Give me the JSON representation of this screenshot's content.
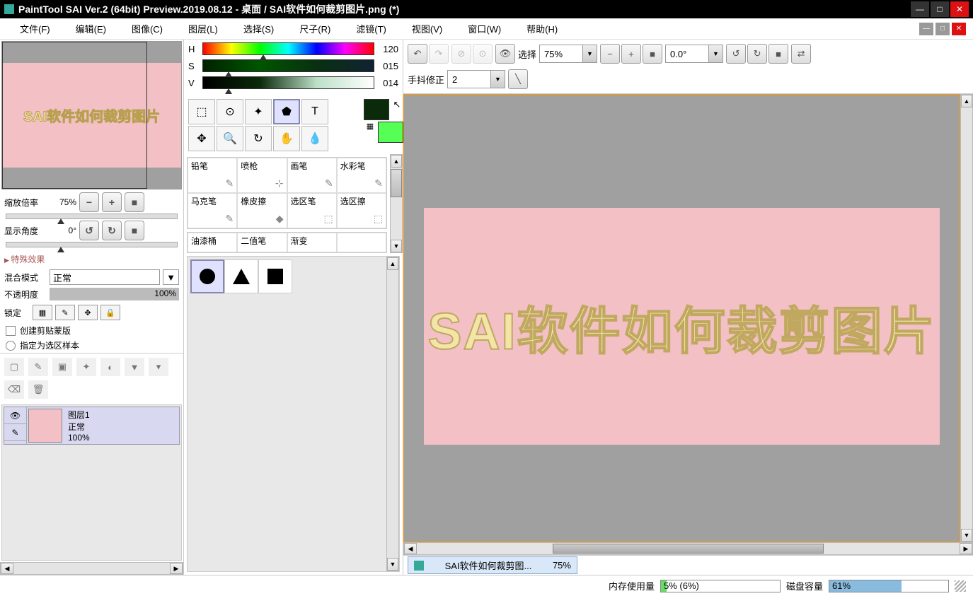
{
  "window": {
    "title": "PaintTool SAI Ver.2 (64bit) Preview.2019.08.12 - 桌面 / SAI软件如何裁剪图片.png (*)"
  },
  "menu": {
    "file": "文件(F)",
    "edit": "编辑(E)",
    "image": "图像(C)",
    "layer": "图层(L)",
    "select": "选择(S)",
    "ruler": "尺子(R)",
    "filter": "滤镜(T)",
    "view": "视图(V)",
    "window": "窗口(W)",
    "help": "帮助(H)"
  },
  "navigator": {
    "text": "SAI软件如何裁剪图片",
    "zoom_label": "缩放倍率",
    "zoom_value": "75%",
    "angle_label": "显示角度",
    "angle_value": "0°"
  },
  "effects_header": "特殊效果",
  "blend": {
    "label": "混合模式",
    "value": "正常"
  },
  "opacity": {
    "label": "不透明度",
    "value": "100%"
  },
  "lock_label": "锁定",
  "clip_label": "创建剪贴蒙版",
  "seltarget_label": "指定为选区样本",
  "layer": {
    "name": "图层1",
    "mode": "正常",
    "opacity": "100%"
  },
  "hsv": {
    "h": "H",
    "s": "S",
    "v": "V",
    "h_val": "120",
    "s_val": "015",
    "v_val": "014"
  },
  "brushes": {
    "pencil": "铅笔",
    "airbrush": "喷枪",
    "brush": "画笔",
    "water": "水彩笔",
    "marker": "马克笔",
    "eraser": "橡皮擦",
    "selpen": "选区笔",
    "seleraser": "选区擦",
    "bucket": "油漆桶",
    "binary": "二值笔",
    "gradient": "渐变"
  },
  "toolbar": {
    "select_label": "选择",
    "zoom": "75%",
    "angle": "0.0°",
    "stabilizer_label": "手抖修正",
    "stabilizer_value": "2"
  },
  "canvas_text": "SAI软件如何裁剪图片",
  "doctab": {
    "name": "SAI软件如何裁剪图...",
    "zoom": "75%"
  },
  "status": {
    "mem_label": "内存使用量",
    "mem_text": "5% (6%)",
    "mem_fill": 5,
    "disk_label": "磁盘容量",
    "disk_text": "61%",
    "disk_fill": 61
  }
}
